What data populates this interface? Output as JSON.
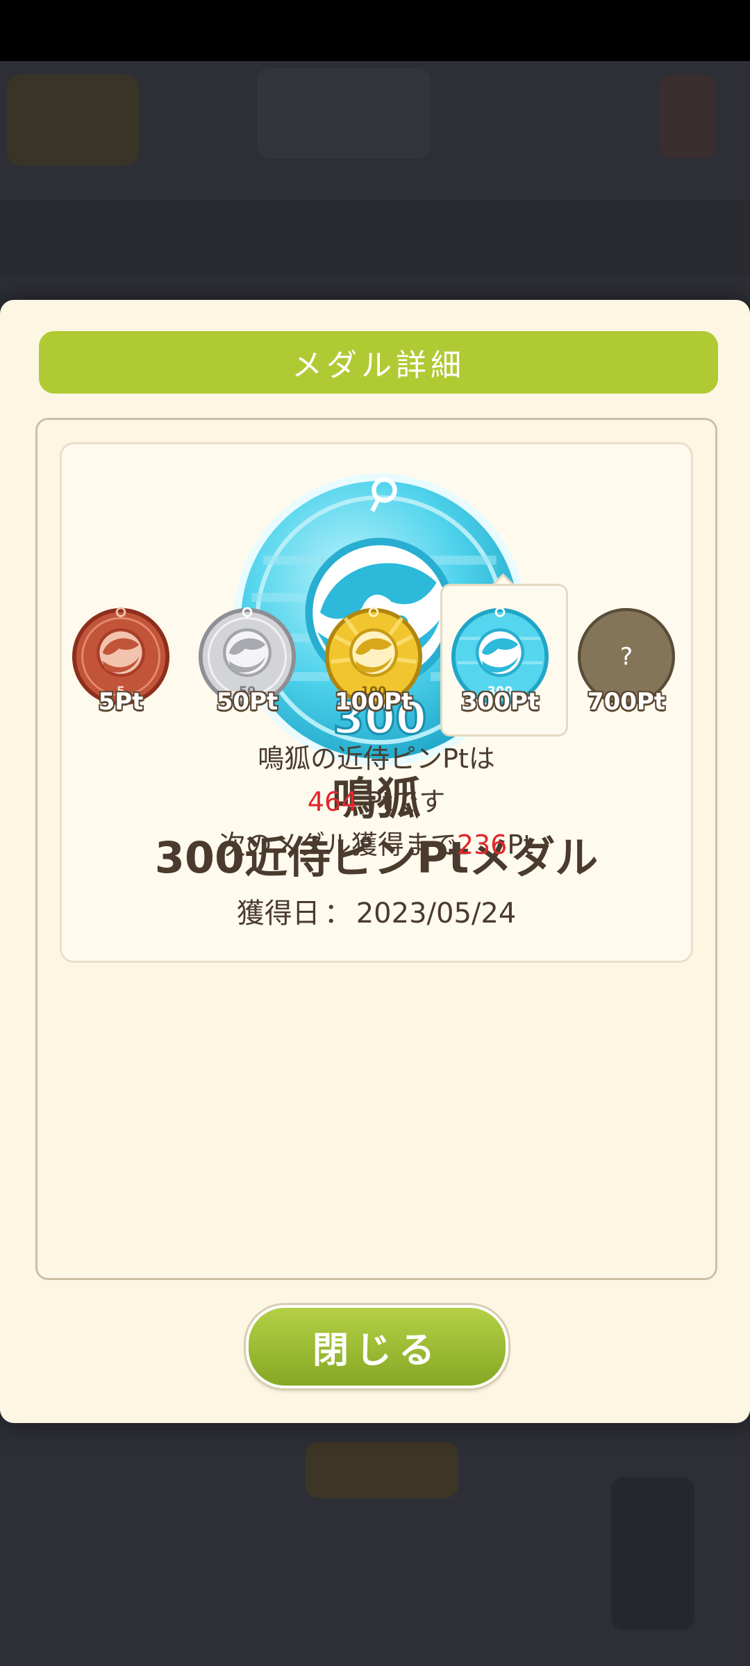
{
  "modal": {
    "header_title": "メダル詳細",
    "medal": {
      "badge_number": "300",
      "character_name": "鳴狐",
      "title": "300近侍ピンPtメダル",
      "date_label": "獲得日",
      "date_sep": "：",
      "date_value": "2023/05/24"
    },
    "tiers": [
      {
        "label": "5Pt",
        "number": "5",
        "type": "bronze",
        "selected": false
      },
      {
        "label": "50Pt",
        "number": "50",
        "type": "silver",
        "selected": false
      },
      {
        "label": "100Pt",
        "number": "100",
        "type": "gold",
        "selected": false
      },
      {
        "label": "300Pt",
        "number": "300",
        "type": "aqua",
        "selected": true
      },
      {
        "label": "700Pt",
        "number": "?",
        "type": "locked",
        "selected": false
      }
    ],
    "info": {
      "line1": "鳴狐の近侍ピンPtは",
      "current_pt": "464",
      "line2_suffix": " Ptです",
      "line3_prefix": "次のメダル獲得まで",
      "remaining_pt": "236",
      "line3_suffix": "Pt"
    },
    "close_label": "閉じる"
  },
  "colors": {
    "header_green": "#b0ca33",
    "text_brown": "#4a3b2d",
    "highlight_red": "#e0282d",
    "modal_bg": "#fcf6e3"
  }
}
